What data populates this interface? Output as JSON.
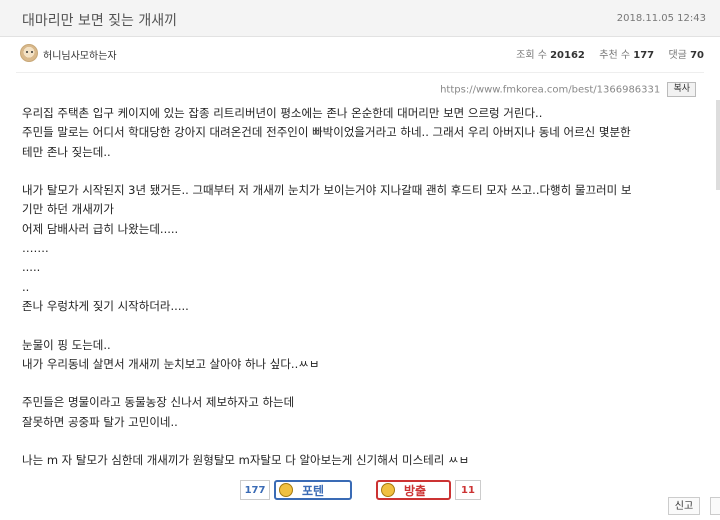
{
  "post": {
    "title": "대마리만 보면 짖는 개새끼",
    "date": "2018.11.05 12:43"
  },
  "author": {
    "name": "허니님사모하는자"
  },
  "stats": {
    "views_label": "조회 수",
    "views": "20162",
    "recommend_label": "추천 수",
    "recommend": "177",
    "comments_label": "댓글",
    "comments": "70"
  },
  "source": {
    "url": "https://www.fmkorea.com/best/1366986331",
    "copy_label": "복사"
  },
  "body": {
    "lines": [
      "우리집 주택촌 입구 케이지에 있는 잡종 리트리버년이 평소에는 존나 온순한데 대머리만 보면 으르렁 거린다..",
      "주민들 말로는 어디서 학대당한 강아지 대려온건데 전주인이 빠박이었을거라고 하네.. 그래서 우리 아버지나 동네 어르신 몇분한",
      "테만 존나 짖는데..",
      "",
      "내가 탈모가 시작된지 3년 됐거든.. 그때부터 저 개새끼 눈치가 보이는거야 지나갈때 괜히 후드티 모자 쓰고..다행히 물끄러미 보",
      "기만 하던 개새끼가",
      "어제 담배사러   급히 나왔는데.....",
      "…….",
      ".....",
      "..",
      "존나 우렁차게 짖기 시작하더라.....",
      "",
      "눈물이 핑 도는데..",
      "내가 우리동네 살면서 개새끼 눈치보고 살아야 하나 싶다..ㅆㅂ",
      "",
      "주민들은 명물이라고 동물농장 신나서 제보하자고 하는데",
      "잘못하면 공중파 탈가 고민이네..",
      "",
      "나는 m 자 탈모가 심한데 개새끼가 원형탈모 m자탈모 다 알아보는게 신기해서 미스테리 ㅆㅂ"
    ]
  },
  "vote": {
    "up_count": "177",
    "up_label": "포텐",
    "down_label": "방출",
    "down_count": "11"
  },
  "actions": {
    "report_label": "신고"
  },
  "colors": {
    "up_accent": "#3a6bb5",
    "down_accent": "#cc3333"
  }
}
